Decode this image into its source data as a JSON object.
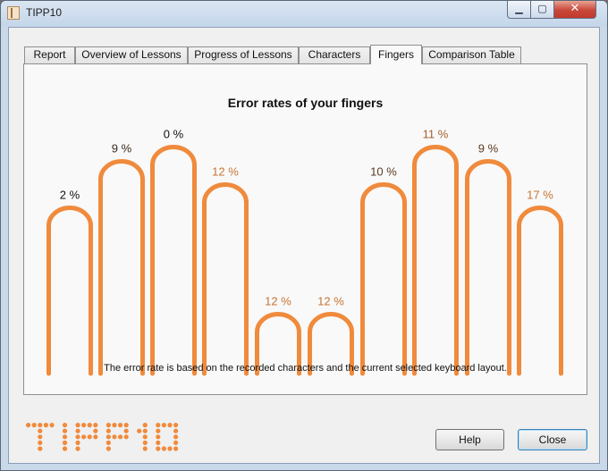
{
  "window": {
    "title": "TIPP10",
    "minimize": "▁",
    "maximize": "▢",
    "close": "✕"
  },
  "tabs": [
    {
      "label": "Report"
    },
    {
      "label": "Overview of Lessons"
    },
    {
      "label": "Progress of Lessons"
    },
    {
      "label": "Characters"
    },
    {
      "label": "Fingers"
    },
    {
      "label": "Comparison Table"
    }
  ],
  "active_tab": "Fingers",
  "chart_title": "Error rates of your fingers",
  "chart_note": "The error rate is based on the recorded characters and the current selected keyboard layout.",
  "chart_data": {
    "type": "bar",
    "title": "Error rates of your fingers",
    "categories": [
      "",
      "",
      "",
      "",
      "",
      "",
      "",
      "",
      "",
      ""
    ],
    "values": [
      2,
      9,
      0,
      12,
      12,
      12,
      10,
      11,
      9,
      17
    ],
    "labels": [
      "2 %",
      "9 %",
      "0 %",
      "12 %",
      "12 %",
      "12 %",
      "10 %",
      "11 %",
      "9 %",
      "17 %"
    ],
    "label_colors": [
      "#111111",
      "#3a2a1e",
      "#111111",
      "#c87533",
      "#c87533",
      "#c87533",
      "#5a3a22",
      "#a8602a",
      "#5a3a22",
      "#c87533"
    ],
    "finger_shape_color": "#f08a3c"
  },
  "buttons": {
    "help": "Help",
    "close": "Close"
  },
  "logo_text": "TIPP10",
  "colors": {
    "accent": "#f08a3c",
    "logo": "#f08a3c"
  }
}
